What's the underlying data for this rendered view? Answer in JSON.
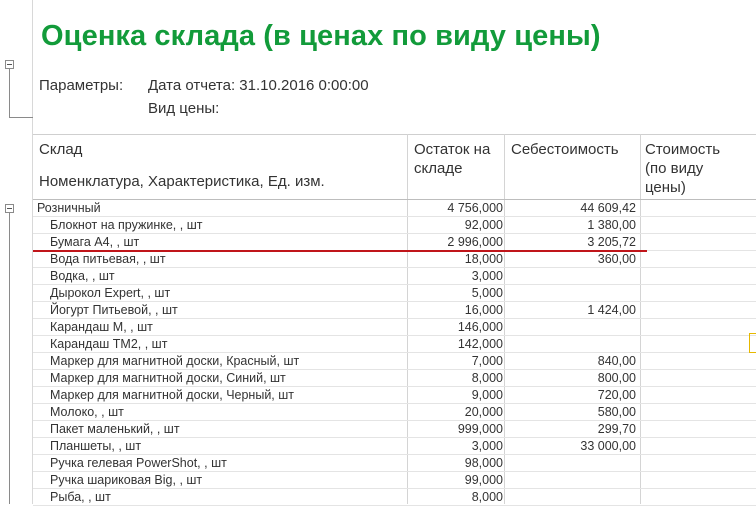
{
  "report": {
    "title": "Оценка склада (в ценах по виду цены)",
    "params_label": "Параметры:",
    "report_date": "Дата отчета: 31.10.2016 0:00:00",
    "price_type": "Вид цены:"
  },
  "columns": {
    "warehouse": "Склад",
    "nomenclature": "Номенклатура, Характеристика, Ед. изм.",
    "stock_line1": "Остаток на",
    "stock_line2": "складе",
    "cost": "Себестоимость",
    "value_line1": "Стоимость",
    "value_line2": "(по виду",
    "value_line3": "цены)"
  },
  "rows": [
    {
      "name": "Розничный",
      "qty": "4 756,000",
      "cost": "44 609,42",
      "group": true
    },
    {
      "name": "Блокнот на пружинке, , шт",
      "qty": "92,000",
      "cost": "1 380,00"
    },
    {
      "name": "Бумага А4, , шт",
      "qty": "2 996,000",
      "cost": "3 205,72"
    },
    {
      "name": "Вода питьевая, , шт",
      "qty": "18,000",
      "cost": "360,00"
    },
    {
      "name": "Водка, , шт",
      "qty": "3,000",
      "cost": ""
    },
    {
      "name": "Дырокол Expert, , шт",
      "qty": "5,000",
      "cost": ""
    },
    {
      "name": "Йогурт Питьевой, , шт",
      "qty": "16,000",
      "cost": "1 424,00"
    },
    {
      "name": "Карандаш М, , шт",
      "qty": "146,000",
      "cost": ""
    },
    {
      "name": "Карандаш ТМ2, , шт",
      "qty": "142,000",
      "cost": ""
    },
    {
      "name": "Маркер для магнитной доски, Красный, шт",
      "qty": "7,000",
      "cost": "840,00"
    },
    {
      "name": "Маркер для магнитной доски, Синий, шт",
      "qty": "8,000",
      "cost": "800,00"
    },
    {
      "name": "Маркер для магнитной доски, Черный, шт",
      "qty": "9,000",
      "cost": "720,00"
    },
    {
      "name": "Молоко, , шт",
      "qty": "20,000",
      "cost": "580,00"
    },
    {
      "name": "Пакет маленький, , шт",
      "qty": "999,000",
      "cost": "299,70"
    },
    {
      "name": "Планшеты, , шт",
      "qty": "3,000",
      "cost": "33 000,00"
    },
    {
      "name": "Ручка гелевая PowerShot, , шт",
      "qty": "98,000",
      "cost": ""
    },
    {
      "name": "Ручка шариковая Big, , шт",
      "qty": "99,000",
      "cost": ""
    },
    {
      "name": "Рыба, , шт",
      "qty": "8,000",
      "cost": ""
    }
  ]
}
